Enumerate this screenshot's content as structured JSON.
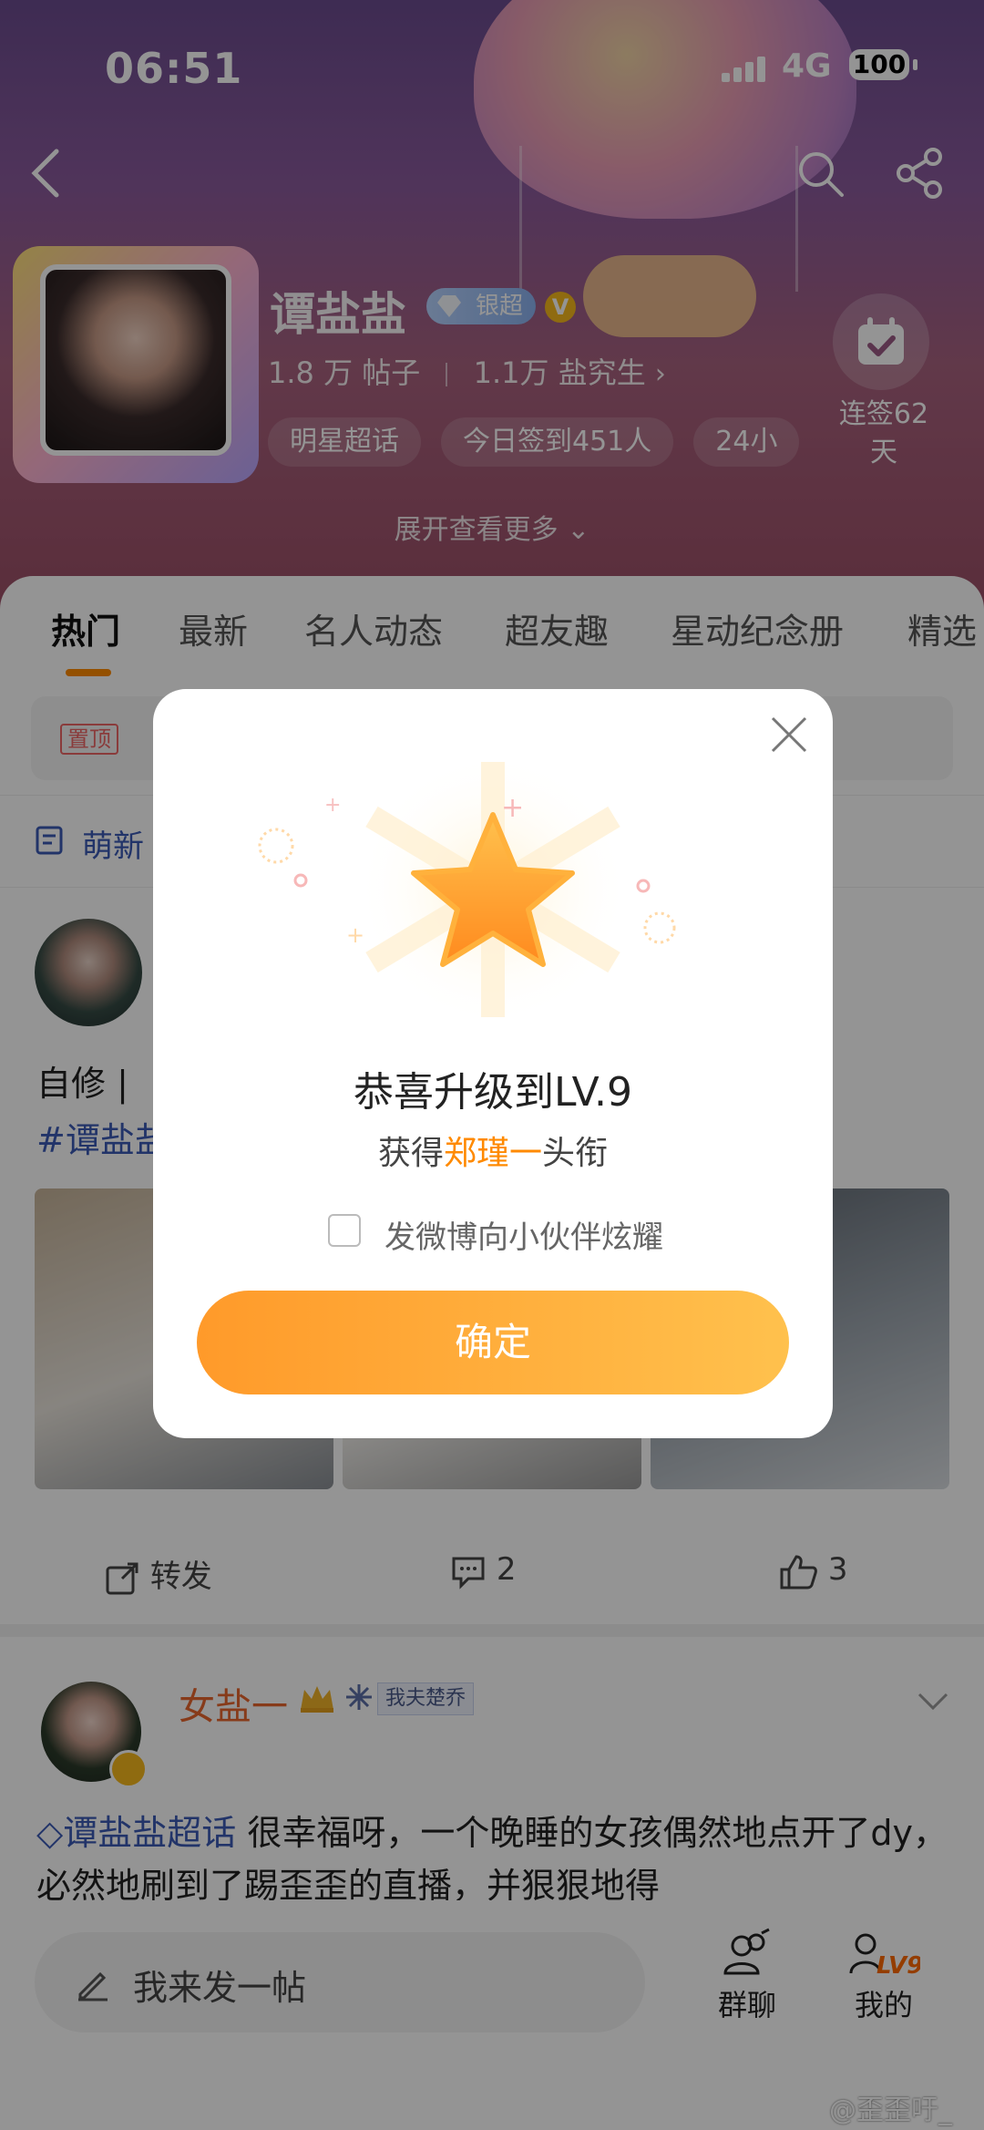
{
  "status_bar": {
    "time": "06:51",
    "network": "4G",
    "battery": "100"
  },
  "header": {
    "name": "谭盐盐",
    "level_badge": "银超",
    "posts_count": "1.8 万",
    "posts_label": "帖子",
    "members_count": "1.1万",
    "members_label": "盐究生",
    "chips": [
      "明星超话",
      "今日签到451人",
      "24小"
    ],
    "checkin_label_line1": "连签62",
    "checkin_label_line2": "天",
    "expand_label": "展开查看更多"
  },
  "tabs": [
    {
      "label": "热门"
    },
    {
      "label": "最新"
    },
    {
      "label": "名人动态"
    },
    {
      "label": "超友趣"
    },
    {
      "label": "星动纪念册"
    },
    {
      "label": "精选"
    }
  ],
  "pinned": {
    "tag": "置顶"
  },
  "newbie": {
    "label": "萌新"
  },
  "post1": {
    "text": "自修 |",
    "tag": "#谭盐盐",
    "actions": {
      "repost": "转发",
      "comments": "2",
      "likes": "3"
    }
  },
  "post2": {
    "author": "女盐一",
    "member_tag": "我夫楚乔",
    "tag": "谭盐盐超话",
    "text": " 很幸福呀，一个晚睡的女孩偶然地点开了dy，必然地刷到了踢歪歪的直播，并狠狠地得"
  },
  "bottom_bar": {
    "compose_placeholder": "我来发一帖",
    "group_chat": "群聊",
    "mine": "我的",
    "level": "LV9"
  },
  "watermark": "@歪歪吁_",
  "dialog": {
    "title": "恭喜升级到LV.9",
    "sub_prefix": "获得",
    "sub_highlight": "郑瑾一",
    "sub_suffix": "头衔",
    "checkbox_label": "发微博向小伙伴炫耀",
    "confirm": "确定"
  },
  "colors": {
    "accent": "#ff8a00",
    "link": "#3b5bb5",
    "button_start": "#ff9a2a",
    "button_end": "#ffc14d"
  }
}
